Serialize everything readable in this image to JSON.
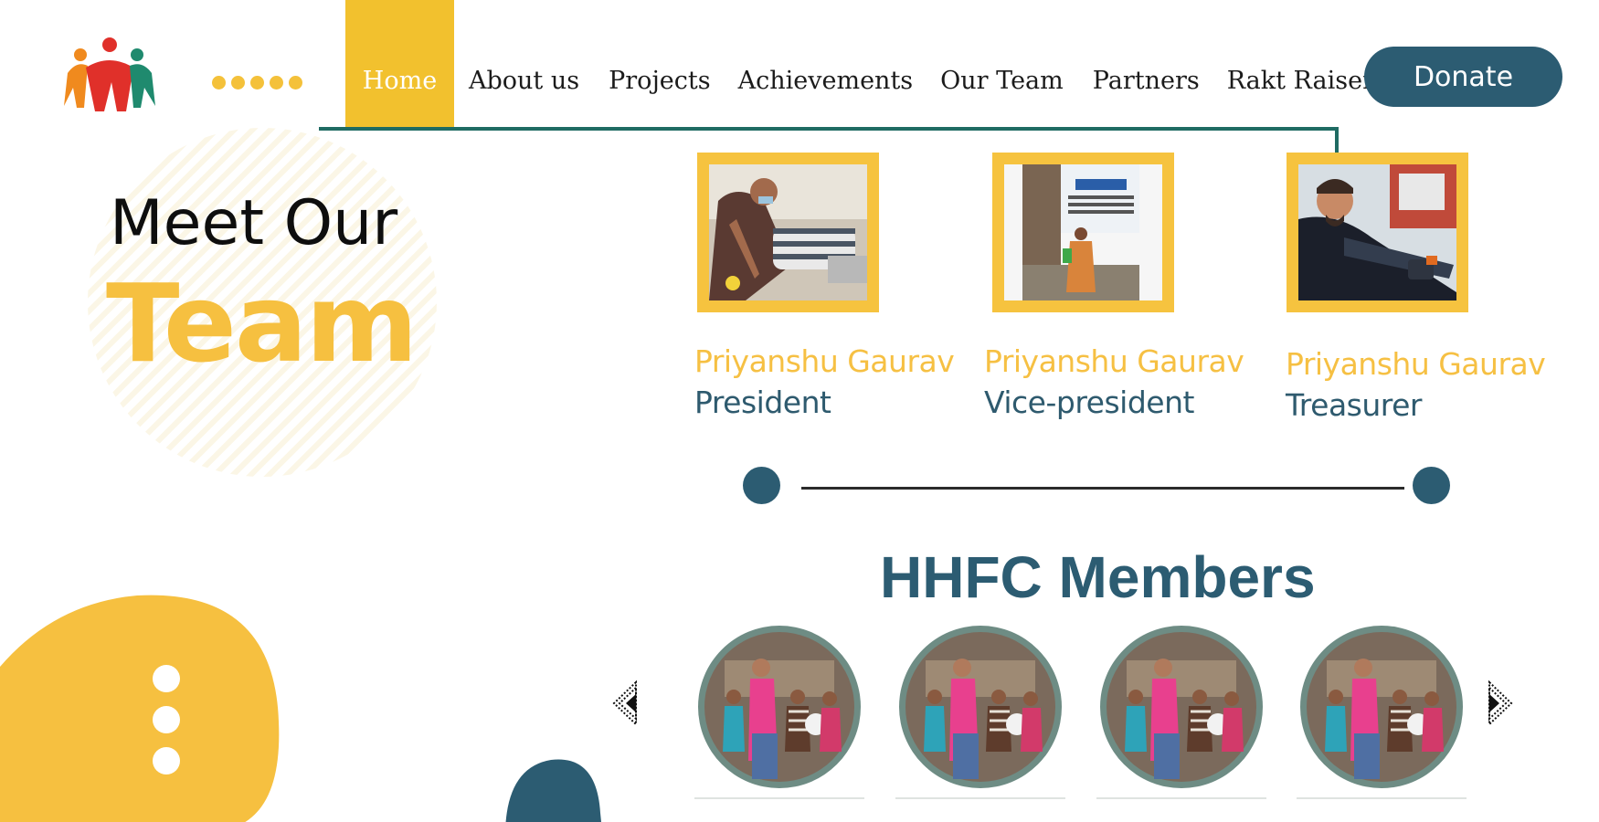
{
  "header": {
    "logo_icon": "people-group-logo",
    "nav": [
      "Home",
      "About us",
      "Projects",
      "Achievements",
      "Our Team",
      "Partners",
      "Rakt Raiser"
    ],
    "active_nav": "Home",
    "donate_label": "Donate"
  },
  "hero": {
    "line1": "Meet Our",
    "line2": "Team"
  },
  "team": [
    {
      "name": "Priyanshu Gaurav",
      "role": "President"
    },
    {
      "name": "Priyanshu Gaurav",
      "role": "Vice-president"
    },
    {
      "name": "Priyanshu Gaurav",
      "role": "Treasurer"
    }
  ],
  "members": {
    "title": "HHFC Members",
    "prev_icon": "triangle-left-icon",
    "next_icon": "triangle-right-icon"
  },
  "colors": {
    "accent_yellow": "#f6c040",
    "brand_teal": "#2c5c72",
    "nav_line": "#1f6b63"
  }
}
